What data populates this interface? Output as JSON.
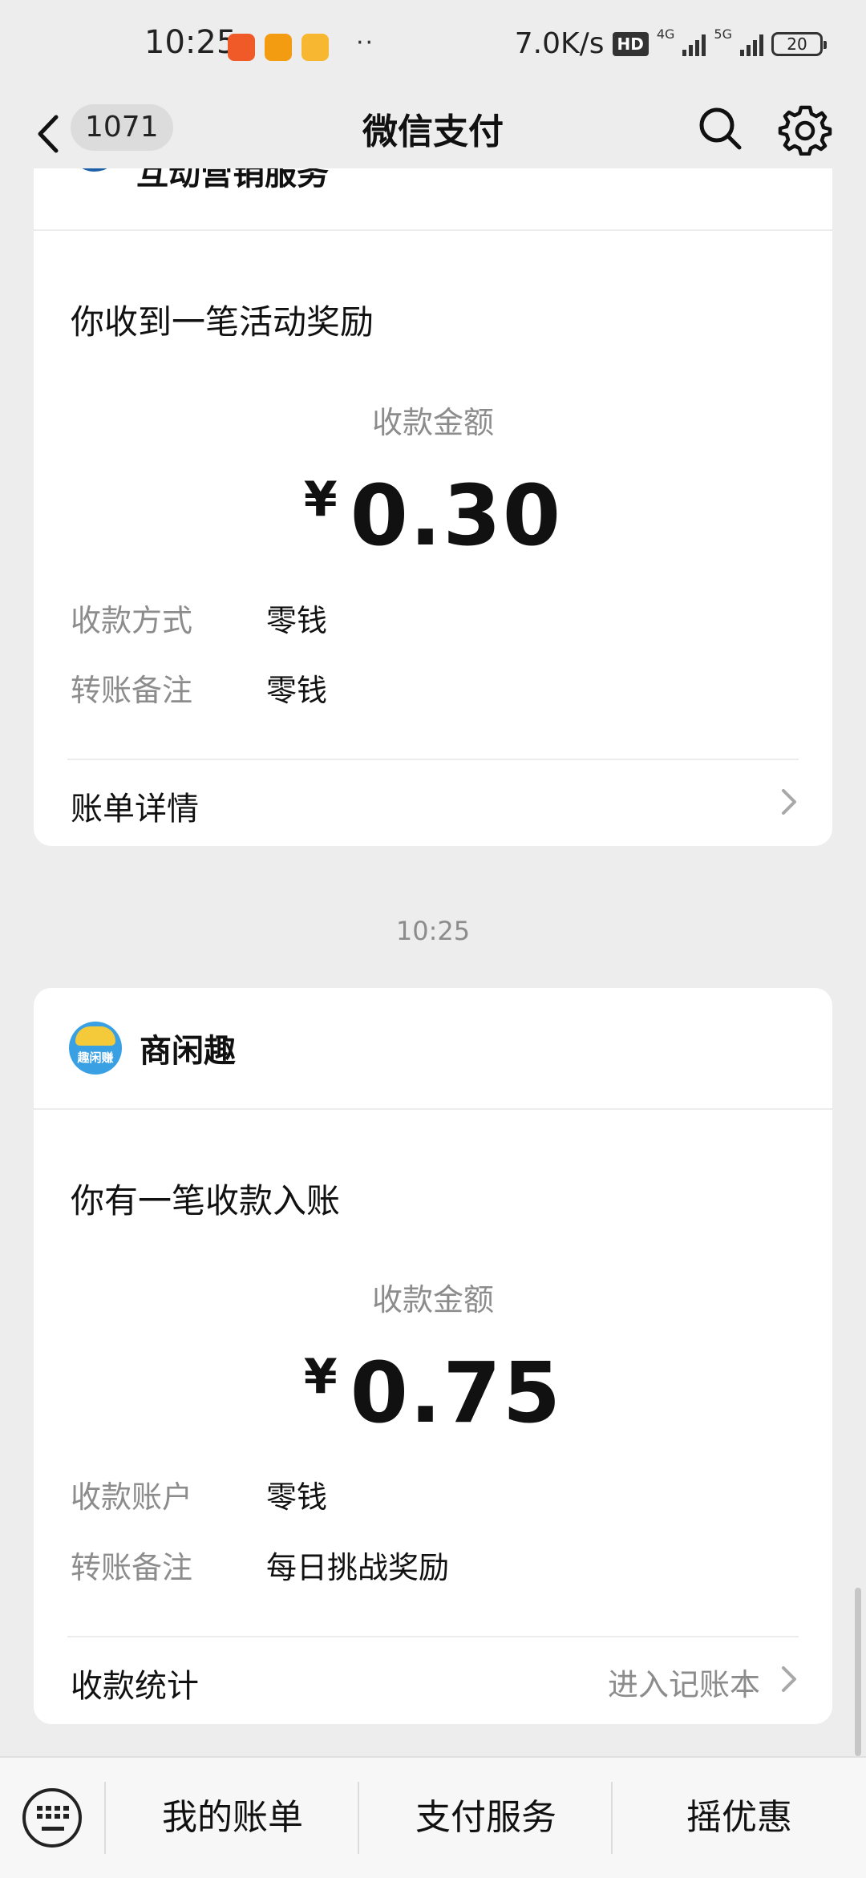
{
  "status_bar": {
    "time": "10:25",
    "more": "··",
    "speed": "7.0K/s",
    "hd": "HD",
    "net1": "4G",
    "net2": "5G",
    "battery": "20"
  },
  "nav": {
    "title": "微信支付",
    "unread_count": "1071"
  },
  "cards": [
    {
      "merchant_name_cut": "互动营销服务",
      "title": "你收到一笔活动奖励",
      "amount_label": "收款金额",
      "currency": "¥",
      "amount": "0.30",
      "rows": [
        {
          "label": "收款方式",
          "value": "零钱"
        },
        {
          "label": "转账备注",
          "value": "零钱"
        }
      ],
      "footer_left": "账单详情",
      "footer_right": ""
    },
    {
      "merchant_name": "商闲趣",
      "logo_text": "趣闲赚",
      "title": "你有一笔收款入账",
      "amount_label": "收款金额",
      "currency": "¥",
      "amount": "0.75",
      "rows": [
        {
          "label": "收款账户",
          "value": "零钱"
        },
        {
          "label": "转账备注",
          "value": "每日挑战奖励"
        }
      ],
      "footer_left": "收款统计",
      "footer_right": "进入记账本"
    }
  ],
  "timestamp": "10:25",
  "bottom_menu": [
    "我的账单",
    "支付服务",
    "摇优惠"
  ],
  "colors": {
    "background": "#ededed",
    "card": "#ffffff",
    "muted_text": "#8c8c8c",
    "logo_blue": "#1a5fa8",
    "logo_light_blue": "#3aa0e4"
  }
}
